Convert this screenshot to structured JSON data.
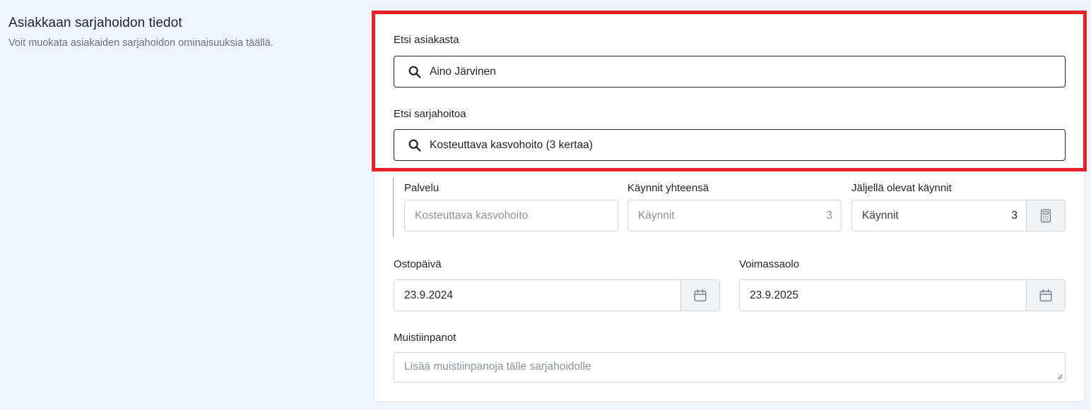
{
  "section": {
    "title": "Asiakkaan sarjahoidon tiedot",
    "subtitle": "Voit muokata asiakaiden sarjahoidon ominaisuuksia täällä."
  },
  "customer_search": {
    "label": "Etsi asiakasta",
    "value": "Aino Järvinen",
    "icon": "search-icon"
  },
  "series_search": {
    "label": "Etsi sarjahoitoa",
    "value": "Kosteuttava kasvohoito (3 kertaa)",
    "icon": "search-icon"
  },
  "service": {
    "label": "Palvelu",
    "placeholder": "Kosteuttava kasvohoito"
  },
  "visits_total": {
    "label": "Käynnit yhteensä",
    "text": "Käynnit",
    "value": "3"
  },
  "visits_remaining": {
    "label": "Jäljellä olevat käynnit",
    "text": "Käynnit",
    "value": "3",
    "icon": "calculator-icon"
  },
  "purchase_date": {
    "label": "Ostopäivä",
    "value": "23.9.2024",
    "icon": "calendar-icon"
  },
  "validity": {
    "label": "Voimassaolo",
    "value": "23.9.2025",
    "icon": "calendar-icon"
  },
  "notes": {
    "label": "Muistiinpanot",
    "placeholder": "Lisää muistiinpanoja tälle sarjahoidolle"
  },
  "colors": {
    "highlight": "#e8202a",
    "background": "#eef6fd",
    "text": "#1f2328",
    "muted": "#8a929b"
  }
}
